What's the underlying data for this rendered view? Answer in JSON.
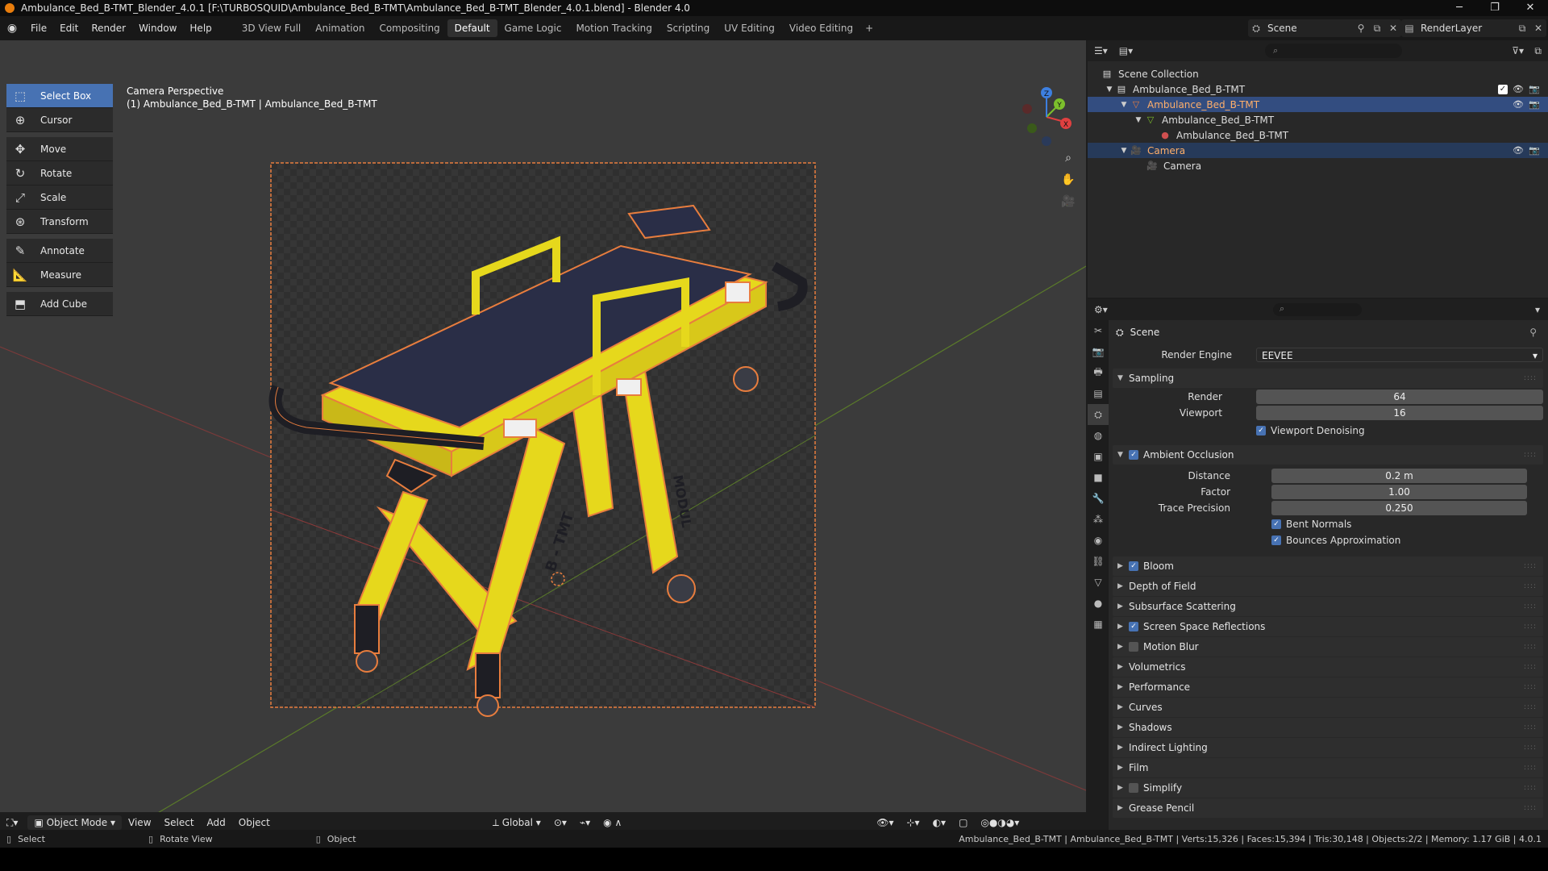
{
  "titlebar": {
    "title": "Ambulance_Bed_B-TMT_Blender_4.0.1 [F:\\TURBOSQUID\\Ambulance_Bed_B-TMT\\Ambulance_Bed_B-TMT_Blender_4.0.1.blend] - Blender 4.0",
    "minimize": "─",
    "maximize": "❐",
    "close": "✕"
  },
  "menu": [
    "File",
    "Edit",
    "Render",
    "Window",
    "Help"
  ],
  "workspaces": [
    "3D View Full",
    "Animation",
    "Compositing",
    "Default",
    "Game Logic",
    "Motion Tracking",
    "Scripting",
    "UV Editing",
    "Video Editing"
  ],
  "active_workspace": "Default",
  "scene_name": "Scene",
  "view_layer": "RenderLayer",
  "viewport": {
    "title_line1": "Camera Perspective",
    "title_line2": "(1) Ambulance_Bed_B-TMT | Ambulance_Bed_B-TMT",
    "model_text_1": "B - TMT",
    "model_text_2": "MODUL",
    "axis_x": "X",
    "axis_y": "Y",
    "axis_z": "Z"
  },
  "tools": [
    {
      "label": "Select Box",
      "icon": "select-box-icon"
    },
    {
      "label": "Cursor",
      "icon": "cursor-icon"
    },
    {
      "label": "Move",
      "icon": "move-icon"
    },
    {
      "label": "Rotate",
      "icon": "rotate-icon"
    },
    {
      "label": "Scale",
      "icon": "scale-icon"
    },
    {
      "label": "Transform",
      "icon": "transform-icon"
    },
    {
      "label": "Annotate",
      "icon": "annotate-icon"
    },
    {
      "label": "Measure",
      "icon": "measure-icon"
    },
    {
      "label": "Add Cube",
      "icon": "add-cube-icon"
    }
  ],
  "viewport_header": {
    "mode": "Object Mode",
    "menus": [
      "View",
      "Select",
      "Add",
      "Object"
    ],
    "orientation": "Global"
  },
  "outliner": {
    "search_placeholder": "",
    "rows": [
      {
        "label": "Scene Collection"
      },
      {
        "label": "Ambulance_Bed_B-TMT"
      },
      {
        "label": "Ambulance_Bed_B-TMT"
      },
      {
        "label": "Ambulance_Bed_B-TMT"
      },
      {
        "label": "Ambulance_Bed_B-TMT"
      },
      {
        "label": "Camera"
      },
      {
        "label": "Camera"
      }
    ]
  },
  "properties": {
    "context": "Scene",
    "render_engine_label": "Render Engine",
    "render_engine": "EEVEE",
    "sampling": {
      "title": "Sampling",
      "render_label": "Render",
      "render": "64",
      "viewport_label": "Viewport",
      "viewport": "16",
      "denoise": "Viewport Denoising"
    },
    "ao": {
      "title": "Ambient Occlusion",
      "distance_label": "Distance",
      "distance": "0.2 m",
      "factor_label": "Factor",
      "factor": "1.00",
      "factor_fill": 1.0,
      "trace_label": "Trace Precision",
      "trace": "0.250",
      "trace_fill": 0.25,
      "bent_normals": "Bent Normals",
      "bounces": "Bounces Approximation"
    },
    "panels": [
      {
        "label": "Bloom",
        "checkbox": true,
        "checked": true
      },
      {
        "label": "Depth of Field"
      },
      {
        "label": "Subsurface Scattering"
      },
      {
        "label": "Screen Space Reflections",
        "checkbox": true,
        "checked": true
      },
      {
        "label": "Motion Blur",
        "checkbox": true,
        "checked": false
      },
      {
        "label": "Volumetrics"
      },
      {
        "label": "Performance"
      },
      {
        "label": "Curves"
      },
      {
        "label": "Shadows"
      },
      {
        "label": "Indirect Lighting"
      },
      {
        "label": "Film"
      },
      {
        "label": "Simplify",
        "checkbox": true,
        "checked": false
      },
      {
        "label": "Grease Pencil"
      }
    ]
  },
  "statusbar": {
    "select": "Select",
    "rotate": "Rotate View",
    "object": "Object",
    "stats": "Ambulance_Bed_B-TMT | Ambulance_Bed_B-TMT | Verts:15,326 | Faces:15,394 | Tris:30,148 | Objects:2/2 | Memory: 1.17 GiB | 4.0.1"
  },
  "colors": {
    "accent": "#4772b3",
    "selection_outline": "#e87d3e",
    "stretcher_yellow": "#e6d81c",
    "mattress": "#2a2e47"
  }
}
